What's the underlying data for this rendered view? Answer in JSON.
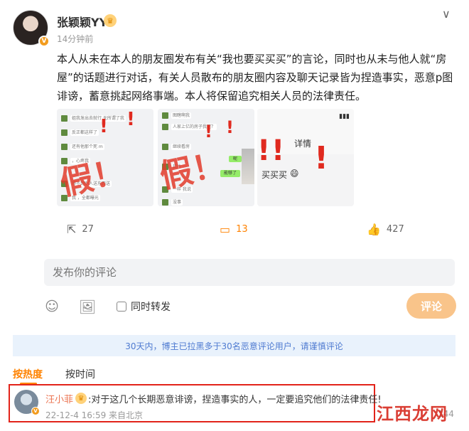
{
  "post": {
    "username": "张颖颖YY",
    "timestamp": "14分钟前",
    "text": "本人从未在本人的朋友圈发布有关“我也要买买买”的言论，同时也从未与他人就“房屋”的话题进行对话，有关人员散布的朋友圈内容及聊天记录皆为捏造事实，恶意p图诽谤，蓄意挑起网络事端。本人将保留追究相关人员的法律责任。",
    "images": [
      {
        "stamp": "假！",
        "chat_lines": [
          "姐我发出去就行 无所谓了我",
          "反正都这样了",
          "还有他那个死 m",
          "，心疼我",
          "等不到别人送东西送",
          "我 ，全都曝光"
        ]
      },
      {
        "stamp": "假！",
        "chat_lines": [
          "图瞎啊我",
          "人家上亿的房子我呢？",
          "继续看房",
          "我也",
          "一样 我说",
          "没事"
        ],
        "bubble_green": "呢",
        "bubble_green2": "能够了"
      },
      {
        "detail_label": "详情",
        "caption": "买买买"
      }
    ],
    "actions": {
      "repost_count": "27",
      "comment_count": "13",
      "like_count": "427"
    }
  },
  "composer": {
    "placeholder": "发布你的评论",
    "repost_label": "同时转发",
    "submit_label": "评论"
  },
  "notice": "30天内，博主已拉黑多于30名恶意评论用户，请谨慎评论",
  "sort": {
    "active": "按热度",
    "other": "按时间"
  },
  "comment": {
    "name": "汪小菲",
    "text": ":对于这几个长期恶意诽谤，捏造事实的人，一定要追究他们的法律责任!",
    "meta": "22-12-4 16:59 来自北京",
    "likes": "144"
  },
  "watermark": "江西龙网",
  "colors": {
    "accent": "#ff8200",
    "link": "#eb7350",
    "notice_text": "#4f7bd1",
    "highlight_frame": "#e2231a"
  }
}
